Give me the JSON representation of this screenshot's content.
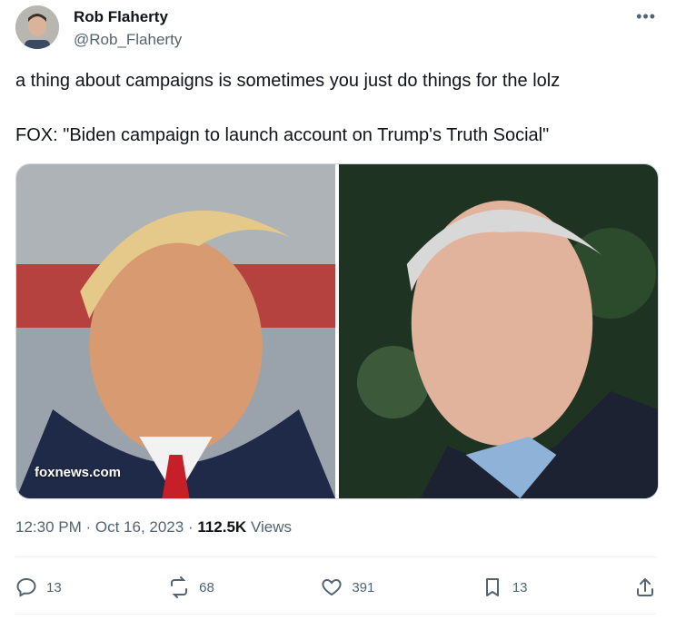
{
  "author": {
    "name": "Rob Flaherty",
    "handle": "@Rob_Flaherty"
  },
  "tweet": {
    "line1": "a thing about campaigns is sometimes you just do things for the lolz",
    "line2": "FOX: \"Biden campaign to launch account on Trump's Truth Social\""
  },
  "media": {
    "watermark": "foxnews.com"
  },
  "meta": {
    "time": "12:30 PM",
    "date": "Oct 16, 2023",
    "views_count": "112.5K",
    "views_label": "Views"
  },
  "actions": {
    "replies": "13",
    "reposts": "68",
    "likes": "391",
    "bookmarks": "13"
  },
  "icons": [
    "more-icon",
    "reply-icon",
    "repost-icon",
    "like-icon",
    "bookmark-icon",
    "share-icon"
  ]
}
